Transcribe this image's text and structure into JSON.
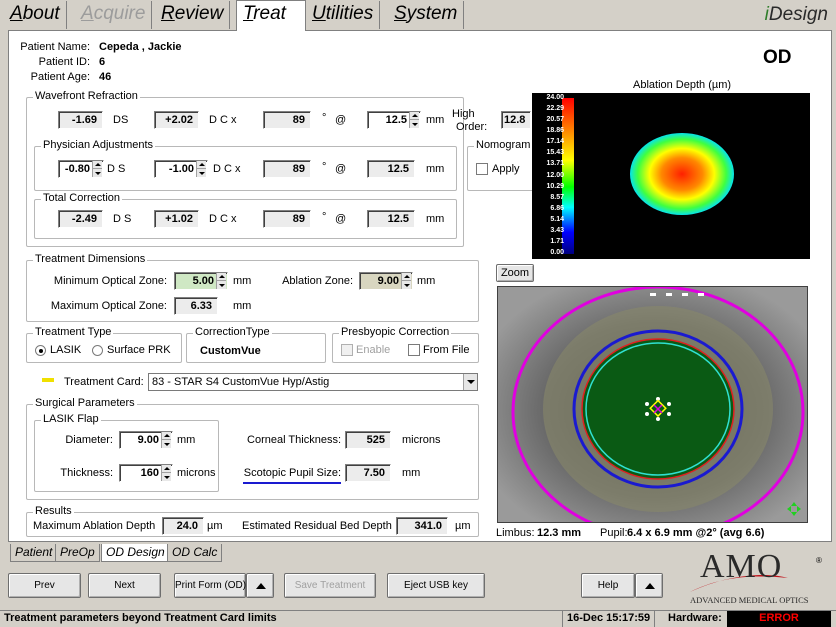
{
  "tabs": [
    {
      "label": "About",
      "ul": "A",
      "rest": "bout",
      "state": "normal"
    },
    {
      "label": "Acquire",
      "ul": "A",
      "rest": "cquire",
      "state": "disabled"
    },
    {
      "label": "Review",
      "ul": "R",
      "rest": "eview",
      "state": "normal"
    },
    {
      "label": "Treat",
      "ul": "T",
      "rest": "reat",
      "state": "active"
    },
    {
      "label": "Utilities",
      "ul": "U",
      "rest": "tilities",
      "state": "normal"
    },
    {
      "label": "System",
      "ul": "S",
      "rest": "ystem",
      "state": "normal"
    }
  ],
  "brand": {
    "idesign_i": "i",
    "idesign_rest": "Design"
  },
  "patient": {
    "name_label": "Patient Name:",
    "name": "Cepeda , Jackie",
    "id_label": "Patient ID:",
    "id": "6",
    "age_label": "Patient Age:",
    "age": "46"
  },
  "eye": "OD",
  "wavefront": {
    "title": "Wavefront Refraction",
    "sphere": "-1.69",
    "ds": "DS",
    "cyl": "+2.02",
    "dcx": "D C x",
    "axis": "89",
    "deg": "°",
    "at": "@",
    "vd": "12.5",
    "mm": "mm",
    "high_order_label_1": "High",
    "high_order_label_2": "Order:",
    "high_order": "12.8",
    "pct": "%"
  },
  "physician": {
    "title": "Physician Adjustments",
    "sphere": "-0.80",
    "ds": "D S",
    "cyl": "-1.00",
    "dcx": "D C x",
    "axis": "89",
    "deg": "°",
    "at": "@",
    "vd": "12.5",
    "mm": "mm"
  },
  "nomogram": {
    "title": "Nomogram",
    "apply": "Apply"
  },
  "total": {
    "title": "Total Correction",
    "sphere": "-2.49",
    "ds": "D S",
    "cyl": "+1.02",
    "dcx": "D C x",
    "axis": "89",
    "deg": "°",
    "at": "@",
    "vd": "12.5",
    "mm": "mm"
  },
  "ablation_map": {
    "title": "Ablation Depth  (µm)",
    "scale": [
      "24.00",
      "22.29",
      "20.57",
      "18.86",
      "17.14",
      "15.43",
      "13.71",
      "12.00",
      "10.29",
      "8.57",
      "6.86",
      "5.14",
      "3.43",
      "1.71",
      "0.00"
    ]
  },
  "dimensions": {
    "title": "Treatment Dimensions",
    "min_oz_label": "Minimum Optical Zone:",
    "min_oz": "5.00",
    "mm": "mm",
    "abl_zone_label": "Ablation Zone:",
    "abl_zone": "9.00",
    "max_oz_label": "Maximum Optical Zone:",
    "max_oz": "6.33"
  },
  "zoom": "Zoom",
  "treatment_type": {
    "title": "Treatment Type",
    "lasik": "LASIK",
    "prk": "Surface PRK",
    "selected": "LASIK"
  },
  "correction_type": {
    "title": "CorrectionType",
    "value": "CustomVue"
  },
  "presbyopic": {
    "title": "Presbyopic Correction",
    "enable": "Enable",
    "from_file": "From File"
  },
  "treatment_card": {
    "label": "Treatment Card:",
    "value": "83 - STAR S4 CustomVue Hyp/Astig"
  },
  "surgical": {
    "title": "Surgical Parameters",
    "flap_title": "LASIK Flap",
    "diameter_label": "Diameter:",
    "diameter": "9.00",
    "mm": "mm",
    "thickness_label": "Thickness:",
    "thickness": "160",
    "microns": "microns",
    "corneal_label": "Corneal Thickness:",
    "corneal": "525",
    "scotopic_label": "Scotopic Pupil Size:",
    "scotopic": "7.50"
  },
  "results": {
    "title": "Results",
    "max_abl_label": "Maximum Ablation Depth",
    "max_abl": "24.0",
    "um": "µm",
    "residual_label": "Estimated Residual Bed Depth",
    "residual": "341.0"
  },
  "eye_info": {
    "limbus_label": "Limbus:",
    "limbus": "12.3 mm",
    "pupil_label": "Pupil:",
    "pupil": "6.4 x 6.9 mm @2° (avg 6.6)"
  },
  "subtabs": [
    {
      "label": "Patient",
      "active": false
    },
    {
      "label": "PreOp",
      "active": false
    },
    {
      "label": "OD Design",
      "active": true
    },
    {
      "label": "OD Calc",
      "active": false
    }
  ],
  "buttons": {
    "prev": "Prev",
    "next": "Next",
    "print": "Print Form (OD)",
    "save": "Save Treatment",
    "eject": "Eject USB key",
    "help": "Help"
  },
  "logo": {
    "amo": "AMO",
    "reg": "®",
    "tagline": "ADVANCED MEDICAL OPTICS"
  },
  "status": {
    "message": "Treatment parameters beyond Treatment Card limits",
    "datetime": "16-Dec 15:17:59",
    "hardware_label": "Hardware:",
    "hardware": "ERROR"
  },
  "colors": {
    "error": "#ff0000",
    "limbus_ring": "#e000e0",
    "pupil_ring": "#1010d0",
    "treat_zone": "#0a5a14"
  }
}
